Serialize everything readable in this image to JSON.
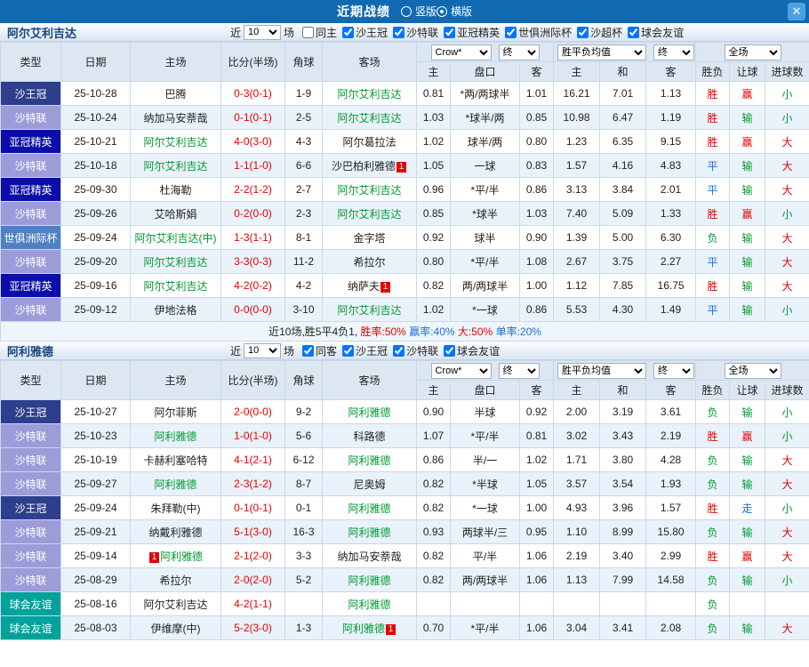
{
  "topbar": {
    "title": "近期战绩",
    "layout_options": [
      {
        "label": "竖版",
        "selected": false
      },
      {
        "label": "横版",
        "selected": true
      }
    ],
    "close_label": "✕"
  },
  "league_colors": {
    "沙王冠": "#2c3e8c",
    "沙特联": "#9c9cd9",
    "亚冠精英": "#0d0daa",
    "世俱洲际杯": "#4f81c2",
    "球会友谊": "#00a29c"
  },
  "result_colors": {
    "胜": "#e60000",
    "平": "#1d6fd1",
    "负": "#009933",
    "赢": "#e60000",
    "走": "#1d6fd1",
    "输": "#009933",
    "大": "#e60000",
    "小": "#009933"
  },
  "text_colors": {
    "team_highlight": "#009933",
    "score": "#e60000"
  },
  "header": {
    "left_cols": [
      "类型",
      "日期",
      "主场",
      "比分(半场)",
      "角球",
      "客场"
    ],
    "ah_group": {
      "selects": [
        "Crow*",
        "终"
      ],
      "cols": [
        "主",
        "盘口",
        "客"
      ]
    },
    "eu_group": {
      "selects": [
        "胜平负均值",
        "终"
      ],
      "cols": [
        "主",
        "和",
        "客"
      ]
    },
    "res_group": {
      "selects": [
        "全场"
      ],
      "cols": [
        "胜负",
        "让球",
        "进球数"
      ]
    }
  },
  "sections": [
    {
      "team": "阿尔艾利吉达",
      "filter": {
        "prefix": "近",
        "count": "10",
        "suffix": "场",
        "options": [
          {
            "label": "同主",
            "checked": false
          },
          {
            "label": "沙王冠",
            "checked": true
          },
          {
            "label": "沙特联",
            "checked": true
          },
          {
            "label": "亚冠精英",
            "checked": true
          },
          {
            "label": "世俱洲际杯",
            "checked": true
          },
          {
            "label": "沙超杯",
            "checked": true
          },
          {
            "label": "球会友谊",
            "checked": true
          }
        ]
      },
      "rows": [
        {
          "league": "沙王冠",
          "date": "25-10-28",
          "home": {
            "n": "巴腾"
          },
          "score": "0-3(0-1)",
          "corners": "1-9",
          "away": {
            "n": "阿尔艾利吉达",
            "g": 1
          },
          "ah": [
            "0.81",
            "*两/两球半",
            "1.01"
          ],
          "eu": [
            "16.21",
            "7.01",
            "1.13"
          ],
          "res": [
            "胜",
            "赢",
            "小"
          ]
        },
        {
          "league": "沙特联",
          "date": "25-10-24",
          "home": {
            "n": "纳加马安萘哉"
          },
          "score": "0-1(0-1)",
          "corners": "2-5",
          "away": {
            "n": "阿尔艾利吉达",
            "g": 1
          },
          "ah": [
            "1.03",
            "*球半/两",
            "0.85"
          ],
          "eu": [
            "10.98",
            "6.47",
            "1.19"
          ],
          "res": [
            "胜",
            "输",
            "小"
          ]
        },
        {
          "league": "亚冠精英",
          "date": "25-10-21",
          "home": {
            "n": "阿尔艾利吉达",
            "g": 1
          },
          "score": "4-0(3-0)",
          "corners": "4-3",
          "away": {
            "n": "阿尔葛拉法"
          },
          "ah": [
            "1.02",
            "球半/两",
            "0.80"
          ],
          "eu": [
            "1.23",
            "6.35",
            "9.15"
          ],
          "res": [
            "胜",
            "赢",
            "大"
          ]
        },
        {
          "league": "沙特联",
          "date": "25-10-18",
          "home": {
            "n": "阿尔艾利吉达",
            "g": 1
          },
          "score": "1-1(1-0)",
          "corners": "6-6",
          "away": {
            "n": "沙巴柏利雅德",
            "b": "1"
          },
          "ah": [
            "1.05",
            "一球",
            "0.83"
          ],
          "eu": [
            "1.57",
            "4.16",
            "4.83"
          ],
          "res": [
            "平",
            "输",
            "大"
          ]
        },
        {
          "league": "亚冠精英",
          "date": "25-09-30",
          "home": {
            "n": "杜海勒"
          },
          "score": "2-2(1-2)",
          "corners": "2-7",
          "away": {
            "n": "阿尔艾利吉达",
            "g": 1
          },
          "ah": [
            "0.96",
            "*平/半",
            "0.86"
          ],
          "eu": [
            "3.13",
            "3.84",
            "2.01"
          ],
          "res": [
            "平",
            "输",
            "大"
          ]
        },
        {
          "league": "沙特联",
          "date": "25-09-26",
          "home": {
            "n": "艾哈斯娟"
          },
          "score": "0-2(0-0)",
          "corners": "2-3",
          "away": {
            "n": "阿尔艾利吉达",
            "g": 1
          },
          "ah": [
            "0.85",
            "*球半",
            "1.03"
          ],
          "eu": [
            "7.40",
            "5.09",
            "1.33"
          ],
          "res": [
            "胜",
            "赢",
            "小"
          ]
        },
        {
          "league": "世俱洲际杯",
          "date": "25-09-24",
          "home": {
            "n": "阿尔艾利吉达(中)",
            "g": 1
          },
          "score": "1-3(1-1)",
          "corners": "8-1",
          "away": {
            "n": "金字塔"
          },
          "ah": [
            "0.92",
            "球半",
            "0.90"
          ],
          "eu": [
            "1.39",
            "5.00",
            "6.30"
          ],
          "res": [
            "负",
            "输",
            "大"
          ]
        },
        {
          "league": "沙特联",
          "date": "25-09-20",
          "home": {
            "n": "阿尔艾利吉达",
            "g": 1
          },
          "score": "3-3(0-3)",
          "corners": "11-2",
          "away": {
            "n": "希拉尔"
          },
          "ah": [
            "0.80",
            "*平/半",
            "1.08"
          ],
          "eu": [
            "2.67",
            "3.75",
            "2.27"
          ],
          "res": [
            "平",
            "输",
            "大"
          ]
        },
        {
          "league": "亚冠精英",
          "date": "25-09-16",
          "home": {
            "n": "阿尔艾利吉达",
            "g": 1
          },
          "score": "4-2(0-2)",
          "corners": "4-2",
          "away": {
            "n": "纳萨夫",
            "b": "1"
          },
          "ah": [
            "0.82",
            "两/两球半",
            "1.00"
          ],
          "eu": [
            "1.12",
            "7.85",
            "16.75"
          ],
          "res": [
            "胜",
            "输",
            "大"
          ]
        },
        {
          "league": "沙特联",
          "date": "25-09-12",
          "home": {
            "n": "伊地法格"
          },
          "score": "0-0(0-0)",
          "corners": "3-10",
          "away": {
            "n": "阿尔艾利吉达",
            "g": 1
          },
          "ah": [
            "1.02",
            "*一球",
            "0.86"
          ],
          "eu": [
            "5.53",
            "4.30",
            "1.49"
          ],
          "res": [
            "平",
            "输",
            "小"
          ]
        }
      ],
      "summary": [
        {
          "text": "近10场,胜5平4负1, ",
          "color": "#222222"
        },
        {
          "text": "胜率:50% ",
          "color": "#e60000"
        },
        {
          "text": "赢率:40% ",
          "color": "#1d6fd1"
        },
        {
          "text": "大:50% ",
          "color": "#e60000"
        },
        {
          "text": "单率:20%",
          "color": "#1d6fd1"
        }
      ]
    },
    {
      "team": "阿利雅德",
      "filter": {
        "prefix": "近",
        "count": "10",
        "suffix": "场",
        "options": [
          {
            "label": "同客",
            "checked": true
          },
          {
            "label": "沙王冠",
            "checked": true
          },
          {
            "label": "沙特联",
            "checked": true
          },
          {
            "label": "球会友谊",
            "checked": true
          }
        ]
      },
      "rows": [
        {
          "league": "沙王冠",
          "date": "25-10-27",
          "home": {
            "n": "阿尔菲斯"
          },
          "score": "2-0(0-0)",
          "corners": "9-2",
          "away": {
            "n": "阿利雅德",
            "g": 1
          },
          "ah": [
            "0.90",
            "半球",
            "0.92"
          ],
          "eu": [
            "2.00",
            "3.19",
            "3.61"
          ],
          "res": [
            "负",
            "输",
            "小"
          ]
        },
        {
          "league": "沙特联",
          "date": "25-10-23",
          "home": {
            "n": "阿利雅德",
            "g": 1
          },
          "score": "1-0(1-0)",
          "corners": "5-6",
          "away": {
            "n": "科路德"
          },
          "ah": [
            "1.07",
            "*平/半",
            "0.81"
          ],
          "eu": [
            "3.02",
            "3.43",
            "2.19"
          ],
          "res": [
            "胜",
            "赢",
            "小"
          ]
        },
        {
          "league": "沙特联",
          "date": "25-10-19",
          "home": {
            "n": "卡赫利塞哈特"
          },
          "score": "4-1(2-1)",
          "corners": "6-12",
          "away": {
            "n": "阿利雅德",
            "g": 1
          },
          "ah": [
            "0.86",
            "半/一",
            "1.02"
          ],
          "eu": [
            "1.71",
            "3.80",
            "4.28"
          ],
          "res": [
            "负",
            "输",
            "大"
          ]
        },
        {
          "league": "沙特联",
          "date": "25-09-27",
          "home": {
            "n": "阿利雅德",
            "g": 1
          },
          "score": "2-3(1-2)",
          "corners": "8-7",
          "away": {
            "n": "尼奥姆"
          },
          "ah": [
            "0.82",
            "*半球",
            "1.05"
          ],
          "eu": [
            "3.57",
            "3.54",
            "1.93"
          ],
          "res": [
            "负",
            "输",
            "大"
          ]
        },
        {
          "league": "沙王冠",
          "date": "25-09-24",
          "home": {
            "n": "朱拜勒(中)"
          },
          "score": "0-1(0-1)",
          "corners": "0-1",
          "away": {
            "n": "阿利雅德",
            "g": 1
          },
          "ah": [
            "0.82",
            "*一球",
            "1.00"
          ],
          "eu": [
            "4.93",
            "3.96",
            "1.57"
          ],
          "res": [
            "胜",
            "走",
            "小"
          ]
        },
        {
          "league": "沙特联",
          "date": "25-09-21",
          "home": {
            "n": "纳戴利雅德"
          },
          "score": "5-1(3-0)",
          "corners": "16-3",
          "away": {
            "n": "阿利雅德",
            "g": 1
          },
          "ah": [
            "0.93",
            "两球半/三",
            "0.95"
          ],
          "eu": [
            "1.10",
            "8.99",
            "15.80"
          ],
          "res": [
            "负",
            "输",
            "大"
          ]
        },
        {
          "league": "沙特联",
          "date": "25-09-14",
          "home": {
            "n": "阿利雅德",
            "g": 1,
            "b": "1",
            "bp": "before"
          },
          "score": "2-1(2-0)",
          "corners": "3-3",
          "away": {
            "n": "纳加马安萘哉"
          },
          "ah": [
            "0.82",
            "平/半",
            "1.06"
          ],
          "eu": [
            "2.19",
            "3.40",
            "2.99"
          ],
          "res": [
            "胜",
            "赢",
            "大"
          ]
        },
        {
          "league": "沙特联",
          "date": "25-08-29",
          "home": {
            "n": "希拉尔"
          },
          "score": "2-0(2-0)",
          "corners": "5-2",
          "away": {
            "n": "阿利雅德",
            "g": 1
          },
          "ah": [
            "0.82",
            "两/两球半",
            "1.06"
          ],
          "eu": [
            "1.13",
            "7.99",
            "14.58"
          ],
          "res": [
            "负",
            "输",
            "小"
          ]
        },
        {
          "league": "球会友谊",
          "date": "25-08-16",
          "home": {
            "n": "阿尔艾利吉达"
          },
          "score": "4-2(1-1)",
          "corners": "",
          "away": {
            "n": "阿利雅德",
            "g": 1
          },
          "ah": [
            "",
            "",
            ""
          ],
          "eu": [
            "",
            "",
            ""
          ],
          "res": [
            "负",
            "",
            ""
          ]
        },
        {
          "league": "球会友谊",
          "date": "25-08-03",
          "home": {
            "n": "伊维摩(中)"
          },
          "score": "5-2(3-0)",
          "corners": "1-3",
          "away": {
            "n": "阿利雅德",
            "g": 1,
            "b": "1"
          },
          "ah": [
            "0.70",
            "*平/半",
            "1.06"
          ],
          "eu": [
            "3.04",
            "3.41",
            "2.08"
          ],
          "res": [
            "负",
            "输",
            "大"
          ]
        }
      ]
    }
  ]
}
